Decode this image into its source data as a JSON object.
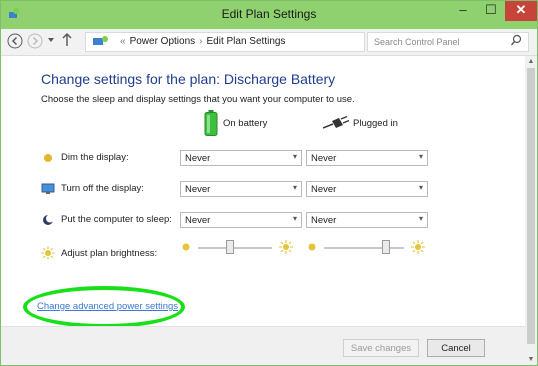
{
  "window": {
    "title": "Edit Plan Settings",
    "minimize": "–",
    "maximize": "☐",
    "close": "✕"
  },
  "address_bar": {
    "breadcrumb": [
      "«",
      "Power Options",
      "›",
      "Edit Plan Settings"
    ],
    "search_placeholder": "Search Control Panel"
  },
  "main": {
    "heading": "Change settings for the plan: Discharge Battery",
    "description": "Choose the sleep and display settings that you want your computer to use.",
    "columns": {
      "battery": "On battery",
      "plugged": "Plugged in"
    },
    "rows": [
      {
        "label": "Dim the display:",
        "battery": "Never",
        "plugged": "Never"
      },
      {
        "label": "Turn off the display:",
        "battery": "Never",
        "plugged": "Never"
      },
      {
        "label": "Put the computer to sleep:",
        "battery": "Never",
        "plugged": "Never"
      }
    ],
    "brightness": {
      "label": "Adjust plan brightness:",
      "battery_level": 0.42,
      "plugged_level": 0.8
    },
    "advanced_link": "Change advanced power settings"
  },
  "footer": {
    "save": "Save changes",
    "cancel": "Cancel"
  },
  "colors": {
    "titlebar": "#8fd16f",
    "heading": "#1e3f8f",
    "link": "#3a78d3",
    "highlight": "#18e018",
    "close": "#c7443a"
  },
  "icons": {
    "app": "power-options-icon",
    "back": "back-arrow-icon",
    "forward": "forward-arrow-icon",
    "up": "up-arrow-icon",
    "search": "search-icon",
    "battery": "battery-icon",
    "plug": "plug-icon"
  }
}
